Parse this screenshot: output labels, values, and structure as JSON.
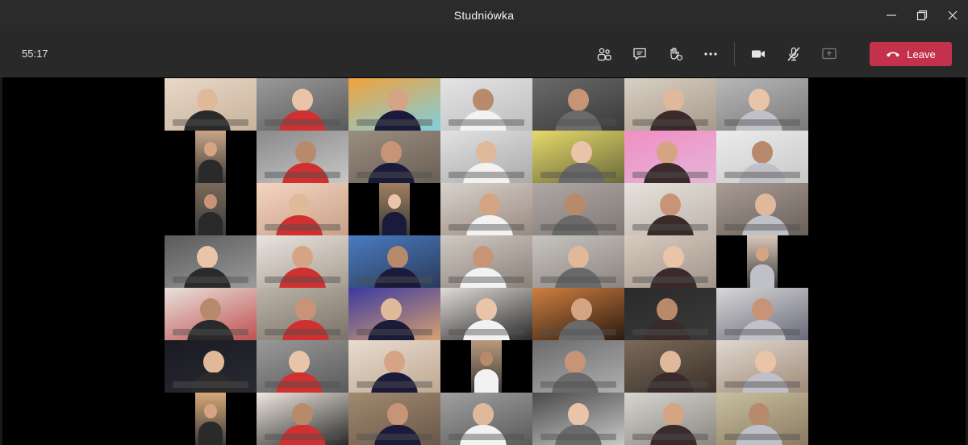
{
  "window": {
    "title": "Studniówka"
  },
  "toolbar": {
    "timer": "55:17",
    "leave_label": "Leave"
  },
  "icons": {
    "people": "people-icon",
    "chat": "chat-icon",
    "reactions": "raise-hand-icon",
    "more": "more-options-icon",
    "camera": "camera-icon",
    "mic": "mic-off-icon",
    "share": "share-screen-icon",
    "hangup": "phone-hangup-icon"
  },
  "colors": {
    "leave": "#c4314b",
    "titlebar": "#2b2b2b",
    "toolbar": "#292929"
  },
  "grid": {
    "rows": 7,
    "cols": 7,
    "participants": 49
  }
}
